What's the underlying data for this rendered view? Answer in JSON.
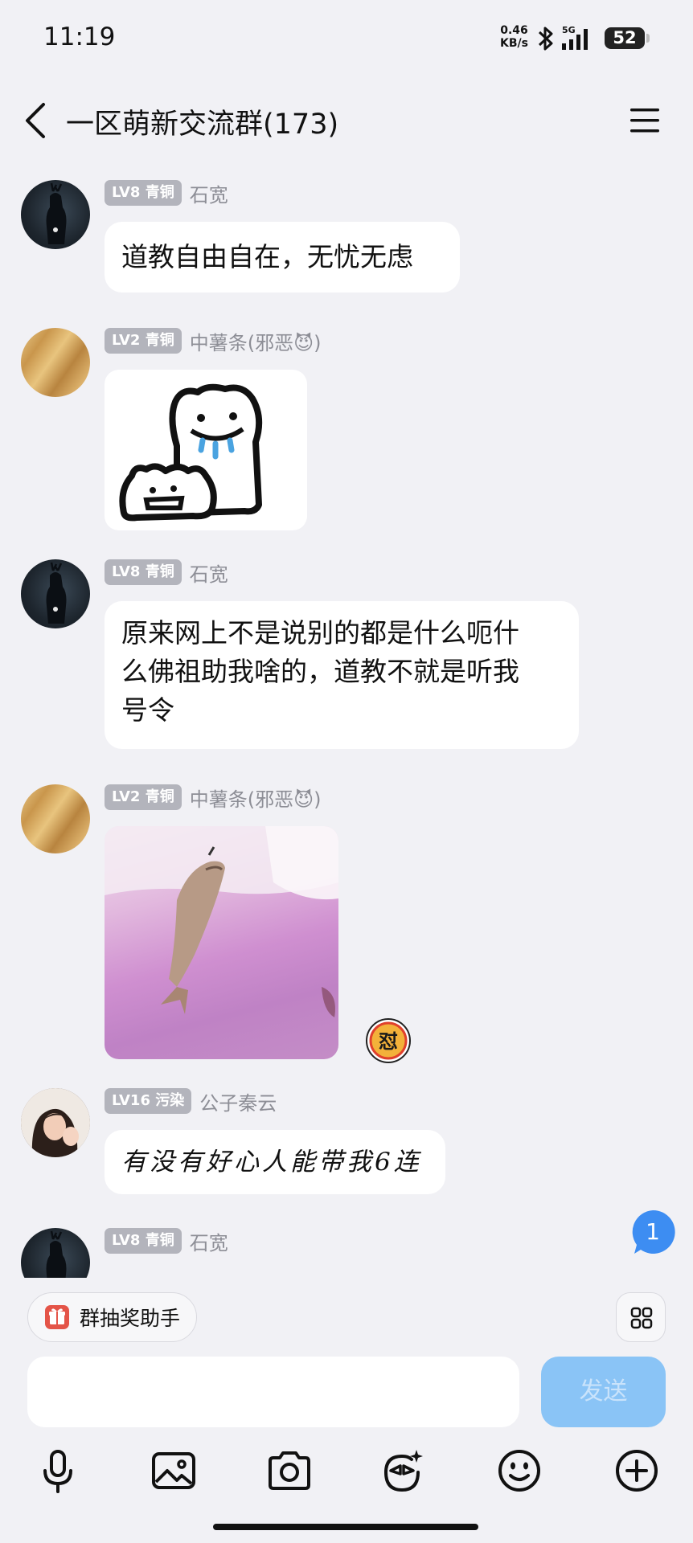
{
  "status_bar": {
    "time": "11:19",
    "net_speed_value": "0.46",
    "net_speed_unit": "KB/s",
    "network_type": "5G",
    "battery_level": "52"
  },
  "header": {
    "title": "一区萌新交流群(173)"
  },
  "messages": [
    {
      "badge": "LV8 青铜",
      "sender": "石宽",
      "type": "text",
      "text": "道教自由自在，无忧无虑",
      "avatar": "deer-avatar"
    },
    {
      "badge": "LV2 青铜",
      "sender": "中薯条(邪恶😈)",
      "type": "sticker",
      "avatar": "gold-avatar"
    },
    {
      "badge": "LV8 青铜",
      "sender": "石宽",
      "type": "text",
      "lines": [
        "原来网上不是说别的都是什么呃什",
        "么佛祖助我啥的，道教不就是听我",
        "号令"
      ],
      "avatar": "deer-avatar"
    },
    {
      "badge": "LV2 青铜",
      "sender": "中薯条(邪恶😈)",
      "type": "image",
      "reaction": "怼",
      "avatar": "gold-avatar"
    },
    {
      "badge": "LV16 污染",
      "sender": "公子秦云",
      "type": "text",
      "text": "有没有好心人能带我6连",
      "avatar": "photo-avatar"
    },
    {
      "badge": "LV8 青铜",
      "sender": "石宽",
      "type": "partial",
      "avatar": "deer-avatar"
    }
  ],
  "unread_count": "1",
  "input": {
    "lottery_label": "群抽奖助手",
    "value": "",
    "send_label": "发送"
  },
  "toolbar": {
    "icons": [
      "microphone-icon",
      "image-icon",
      "camera-icon",
      "face-sticker-icon",
      "emoji-icon",
      "plus-icon"
    ]
  },
  "colors": {
    "background": "#f1f1f5",
    "bubble": "#ffffff",
    "send_button": "#8ac4f6",
    "badge": "#b3b4bc",
    "unread": "#3d8df2"
  }
}
